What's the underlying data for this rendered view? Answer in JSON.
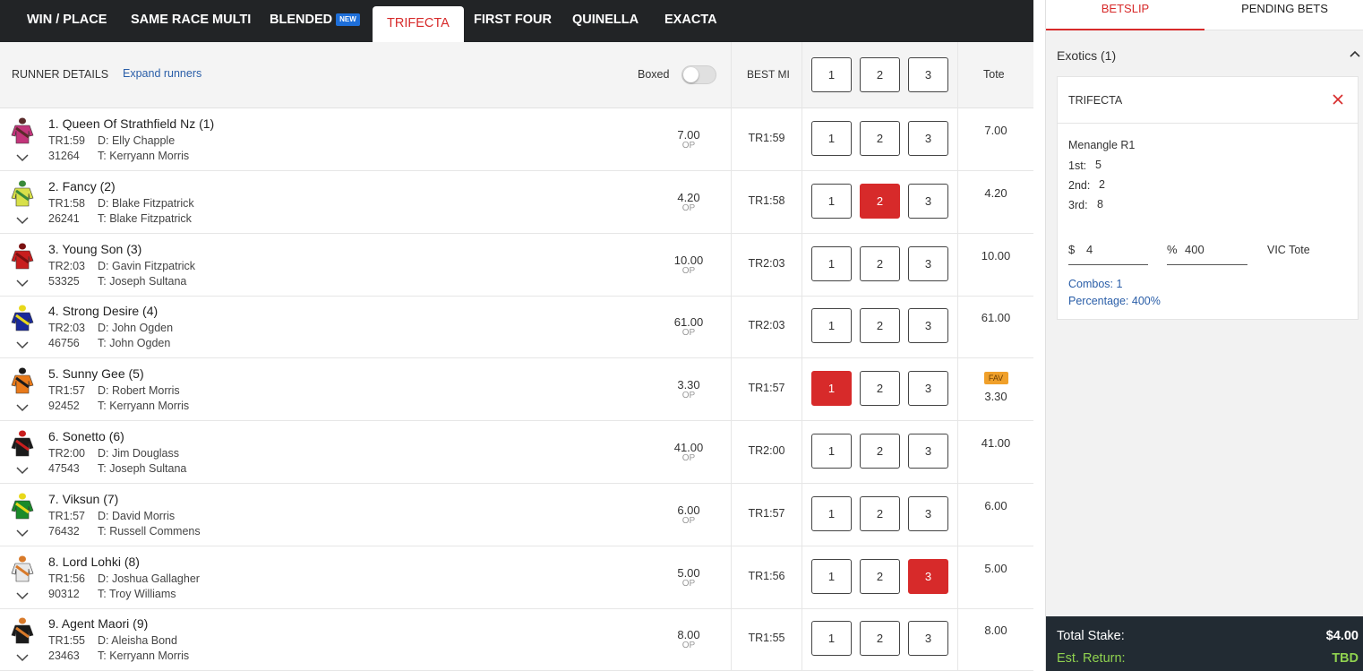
{
  "tabs": [
    {
      "label": "WIN / PLACE"
    },
    {
      "label": "SAME RACE MULTI"
    },
    {
      "label": "BLENDED",
      "badge": "NEW"
    },
    {
      "label": "TRIFECTA"
    },
    {
      "label": "FIRST FOUR"
    },
    {
      "label": "QUINELLA"
    },
    {
      "label": "EXACTA"
    }
  ],
  "active_tab": "TRIFECTA",
  "header": {
    "runner_details": "RUNNER DETAILS",
    "expand_runners": "Expand runners",
    "boxed": "Boxed",
    "boxed_on": false,
    "best_mi": "BEST MI",
    "positions": [
      "1",
      "2",
      "3"
    ],
    "tote": "Tote"
  },
  "runners": [
    {
      "name": "1. Queen Of Strathfield Nz (1)",
      "tr": "TR1:59",
      "driver": "D: Elly Chapple",
      "form": "31264",
      "trainer": "T: Kerryann Morris",
      "odds": "7.00",
      "op": "OP",
      "best_mi": "TR1:59",
      "tote": "7.00",
      "selected": null,
      "silk_colors": [
        "#c2357a",
        "#5a2a2a"
      ]
    },
    {
      "name": "2. Fancy (2)",
      "tr": "TR1:58",
      "driver": "D: Blake Fitzpatrick",
      "form": "26241",
      "trainer": "T: Blake Fitzpatrick",
      "odds": "4.20",
      "op": "OP",
      "best_mi": "TR1:58",
      "tote": "4.20",
      "selected": "2",
      "silk_colors": [
        "#d8e04a",
        "#3a8a3a"
      ]
    },
    {
      "name": "3. Young Son (3)",
      "tr": "TR2:03",
      "driver": "D: Gavin Fitzpatrick",
      "form": "53325",
      "trainer": "T: Joseph Sultana",
      "odds": "10.00",
      "op": "OP",
      "best_mi": "TR2:03",
      "tote": "10.00",
      "selected": null,
      "silk_colors": [
        "#c81e1e",
        "#7a1010"
      ]
    },
    {
      "name": "4. Strong Desire (4)",
      "tr": "TR2:03",
      "driver": "D: John Ogden",
      "form": "46756",
      "trainer": "T: John Ogden",
      "odds": "61.00",
      "op": "OP",
      "best_mi": "TR2:03",
      "tote": "61.00",
      "selected": null,
      "silk_colors": [
        "#1a2a9a",
        "#e8d81a"
      ]
    },
    {
      "name": "5. Sunny Gee (5)",
      "tr": "TR1:57",
      "driver": "D: Robert Morris",
      "form": "92452",
      "trainer": "T: Kerryann Morris",
      "odds": "3.30",
      "op": "OP",
      "best_mi": "TR1:57",
      "tote": "3.30",
      "fav": "FAV",
      "selected": "1",
      "silk_colors": [
        "#e87a1a",
        "#1a1a1a"
      ]
    },
    {
      "name": "6. Sonetto (6)",
      "tr": "TR2:00",
      "driver": "D: Jim Douglass",
      "form": "47543",
      "trainer": "T: Joseph Sultana",
      "odds": "41.00",
      "op": "OP",
      "best_mi": "TR2:00",
      "tote": "41.00",
      "selected": null,
      "silk_colors": [
        "#1a1a1a",
        "#c81e1e"
      ]
    },
    {
      "name": "7. Viksun (7)",
      "tr": "TR1:57",
      "driver": "D: David Morris",
      "form": "76432",
      "trainer": "T: Russell Commens",
      "odds": "6.00",
      "op": "OP",
      "best_mi": "TR1:57",
      "tote": "6.00",
      "selected": null,
      "silk_colors": [
        "#1a8a2a",
        "#e8d81a"
      ]
    },
    {
      "name": "8. Lord Lohki (8)",
      "tr": "TR1:56",
      "driver": "D: Joshua Gallagher",
      "form": "90312",
      "trainer": "T: Troy Williams",
      "odds": "5.00",
      "op": "OP",
      "best_mi": "TR1:56",
      "tote": "5.00",
      "selected": "3",
      "silk_colors": [
        "#e8e8e8",
        "#d87a2a"
      ]
    },
    {
      "name": "9. Agent Maori (9)",
      "tr": "TR1:55",
      "driver": "D: Aleisha Bond",
      "form": "23463",
      "trainer": "T: Kerryann Morris",
      "odds": "8.00",
      "op": "OP",
      "best_mi": "TR1:55",
      "tote": "8.00",
      "selected": null,
      "silk_colors": [
        "#1a1a1a",
        "#d87a2a"
      ]
    }
  ],
  "betslip": {
    "tabs": [
      "BETSLIP",
      "PENDING BETS"
    ],
    "active_tab": "BETSLIP",
    "section_title": "Exotics (1)",
    "bet": {
      "type": "TRIFECTA",
      "race": "Menangle R1",
      "legs": [
        {
          "label": "1st:",
          "value": "5"
        },
        {
          "label": "2nd:",
          "value": "2"
        },
        {
          "label": "3rd:",
          "value": "8"
        }
      ],
      "stake_symbol": "$",
      "stake": "4",
      "percent_symbol": "%",
      "percent": "400",
      "pool": "VIC Tote",
      "combos": "Combos:  1",
      "percentage": "Percentage:  400%"
    },
    "total_stake_label": "Total Stake:",
    "total_stake": "$4.00",
    "est_return_label": "Est. Return:",
    "est_return": "TBD"
  },
  "colors": {
    "accent": "#d72a2a",
    "tabbar": "#222426",
    "link": "#2a5ea8",
    "fav": "#f0a02a",
    "footer": "#222b33",
    "return": "#8fd14f"
  }
}
